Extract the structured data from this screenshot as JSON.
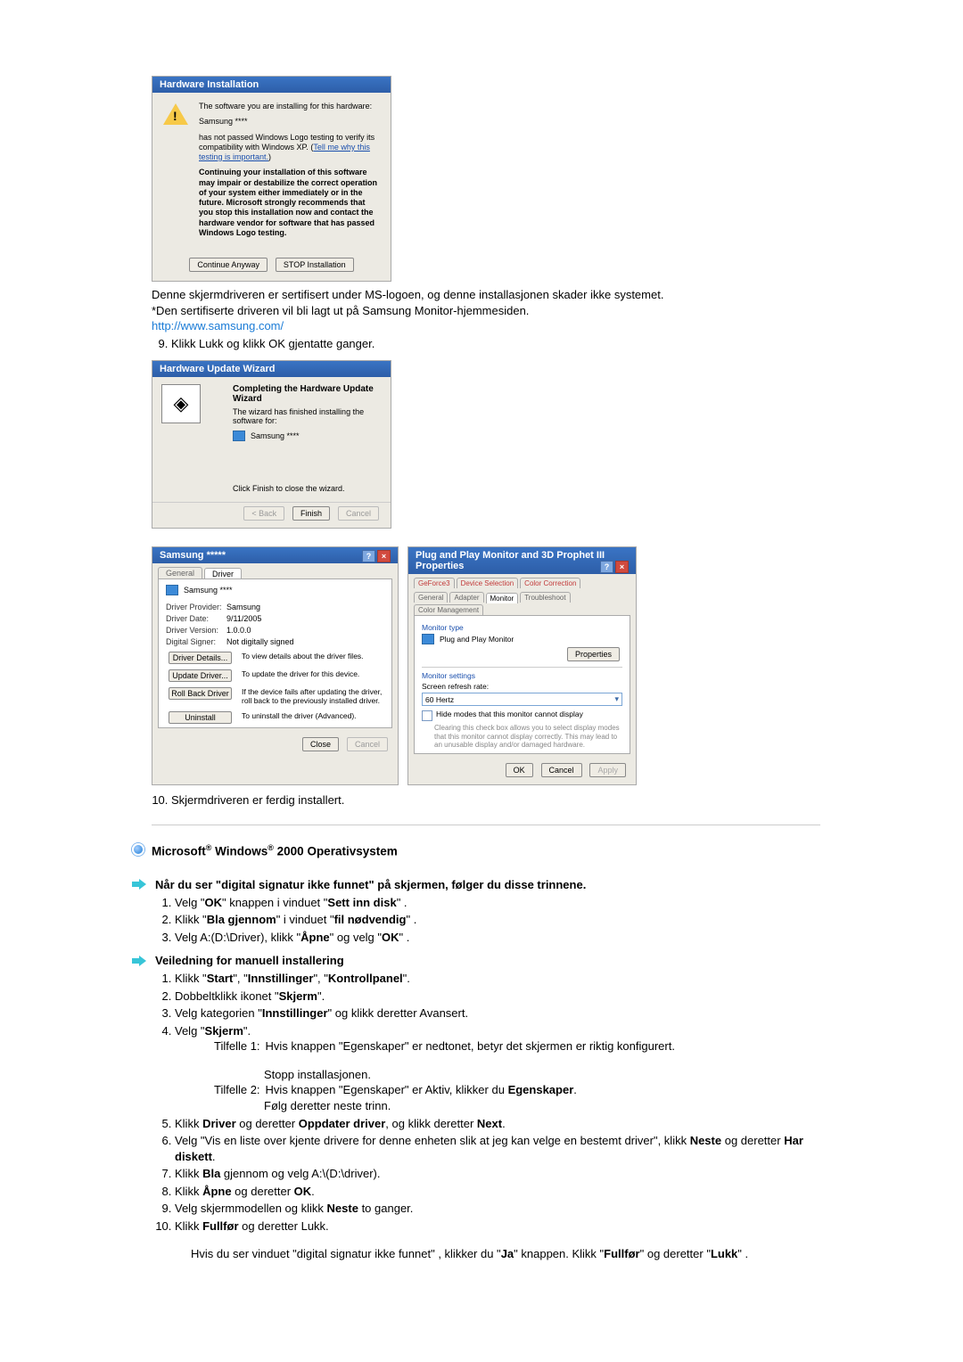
{
  "dlg1": {
    "title": "Hardware Installation",
    "line1": "The software you are installing for this hardware:",
    "device": "Samsung ****",
    "line2_a": "has not passed Windows Logo testing to verify its compatibility with Windows XP. (",
    "line2_link": "Tell me why this testing is important.",
    "line2_b": ")",
    "warn": "Continuing your installation of this software may impair or destabilize the correct operation of your system either immediately or in the future. Microsoft strongly recommends that you stop this installation now and contact the hardware vendor for software that has passed Windows Logo testing.",
    "btn_continue": "Continue Anyway",
    "btn_stop": "STOP Installation"
  },
  "para1": {
    "l1": "Denne skjermdriveren er sertifisert under MS-logoen, og denne installasjonen skader ikke systemet.",
    "l2": "*Den sertifiserte driveren vil bli lagt ut på Samsung Monitor-hjemmesiden.",
    "link_text": "http://www.samsung.com/",
    "step9": "Klikk Lukk og klikk OK gjentatte ganger."
  },
  "dlg2": {
    "title": "Hardware Update Wizard",
    "heading": "Completing the Hardware Update Wizard",
    "sub": "The wizard has finished installing the software for:",
    "device": "Samsung ****",
    "foot": "Click Finish to close the wizard.",
    "btn_back": "< Back",
    "btn_finish": "Finish",
    "btn_cancel": "Cancel"
  },
  "dlg3": {
    "title": "Samsung *****",
    "tab_general": "General",
    "tab_driver": "Driver",
    "device": "Samsung ****",
    "rows": {
      "provider_l": "Driver Provider:",
      "provider_v": "Samsung",
      "date_l": "Driver Date:",
      "date_v": "9/11/2005",
      "ver_l": "Driver Version:",
      "ver_v": "1.0.0.0",
      "signer_l": "Digital Signer:",
      "signer_v": "Not digitally signed"
    },
    "actions": {
      "details_btn": "Driver Details...",
      "details_txt": "To view details about the driver files.",
      "update_btn": "Update Driver...",
      "update_txt": "To update the driver for this device.",
      "rollback_btn": "Roll Back Driver",
      "rollback_txt": "If the device fails after updating the driver, roll back to the previously installed driver.",
      "uninstall_btn": "Uninstall",
      "uninstall_txt": "To uninstall the driver (Advanced)."
    },
    "btn_close": "Close",
    "btn_cancel": "Cancel"
  },
  "dlg4": {
    "title": "Plug and Play Monitor and 3D Prophet III Properties",
    "tabs": {
      "r1a": "GeForce3",
      "r1b": "Device Selection",
      "r1c": "Color Correction",
      "r2a": "General",
      "r2b": "Adapter",
      "r2c": "Monitor",
      "r2d": "Troubleshoot",
      "r2e": "Color Management"
    },
    "grp_type": "Monitor type",
    "mon_name": "Plug and Play Monitor",
    "btn_props": "Properties",
    "grp_settings": "Monitor settings",
    "refresh_lbl": "Screen refresh rate:",
    "refresh_val": "60 Hertz",
    "chk_label": "Hide modes that this monitor cannot display",
    "chk_desc": "Clearing this check box allows you to select display modes that this monitor cannot display correctly. This may lead to an unusable display and/or damaged hardware.",
    "btn_ok": "OK",
    "btn_cancel": "Cancel",
    "btn_apply": "Apply"
  },
  "step10": "Skjermdriveren er ferdig installert.",
  "sec_ms2000_a": "Microsoft",
  "sec_ms2000_b": " Windows",
  "sec_ms2000_c": " 2000 Operativsystem",
  "sec_digsig": "Når du ser \"digital signatur ikke funnet\" på skjermen, følger du disse trinnene.",
  "ds_steps": {
    "s1a": "Velg \"",
    "s1b": "OK",
    "s1c": "\" knappen i vinduet \"",
    "s1d": "Sett inn disk",
    "s1e": "\" .",
    "s2a": "Klikk \"",
    "s2b": "Bla gjennom",
    "s2c": "\" i vinduet \"",
    "s2d": "fil nødvendig",
    "s2e": "\" .",
    "s3a": "Velg A:(D:\\Driver), klikk \"",
    "s3b": "Åpne",
    "s3c": "\" og velg \"",
    "s3d": "OK",
    "s3e": "\" ."
  },
  "sec_manual": "Veiledning for manuell installering",
  "man_steps": {
    "s1a": "Klikk \"",
    "s1b": "Start",
    "s1c": "\", \"",
    "s1d": "Innstillinger",
    "s1e": "\", \"",
    "s1f": "Kontrollpanel",
    "s1g": "\".",
    "s2a": "Dobbeltklikk ikonet \"",
    "s2b": "Skjerm",
    "s2c": "\".",
    "s3a": "Velg kategorien \"",
    "s3b": "Innstillinger",
    "s3c": "\" og klikk deretter Avansert.",
    "s4a": "Velg \"",
    "s4b": "Skjerm",
    "s4c": "\".",
    "tilf1_l": "Tilfelle 1:",
    "tilf1_a": "Hvis knappen \"Egenskaper\" er nedtonet, betyr det skjermen er riktig konfigurert.",
    "tilf1_b": "Stopp installasjonen.",
    "tilf2_l": "Tilfelle 2:",
    "tilf2_a1": "Hvis knappen \"Egenskaper\" er Aktiv, klikker du ",
    "tilf2_a2": "Egenskaper",
    "tilf2_a3": ".",
    "tilf2_b": "Følg deretter neste trinn.",
    "s5a": "Klikk ",
    "s5b": "Driver",
    "s5c": " og deretter ",
    "s5d": "Oppdater driver",
    "s5e": ", og klikk deretter ",
    "s5f": "Next",
    "s5g": ".",
    "s6a": "Velg \"Vis en liste over kjente drivere for denne enheten slik at jeg kan velge en bestemt driver\", klikk ",
    "s6b": "Neste",
    "s6c": " og deretter ",
    "s6d": "Har diskett",
    "s6e": ".",
    "s7a": "Klikk ",
    "s7b": "Bla",
    "s7c": " gjennom og velg A:\\(D:\\driver).",
    "s8a": "Klikk ",
    "s8b": "Åpne",
    "s8c": " og deretter ",
    "s8d": "OK",
    "s8e": ".",
    "s9a": "Velg skjermmodellen og klikk ",
    "s9b": "Neste",
    "s9c": " to ganger.",
    "s10a": "Klikk ",
    "s10b": "Fullfør",
    "s10c": " og deretter Lukk."
  },
  "after": {
    "a1": "Hvis du ser vinduet \"digital signatur ikke funnet\" , klikker du \"",
    "a2": "Ja",
    "a3": "\" knappen. Klikk \"",
    "a4": "Fullfør",
    "a5": "\" og deretter \"",
    "a6": "Lukk",
    "a7": "\" ."
  }
}
